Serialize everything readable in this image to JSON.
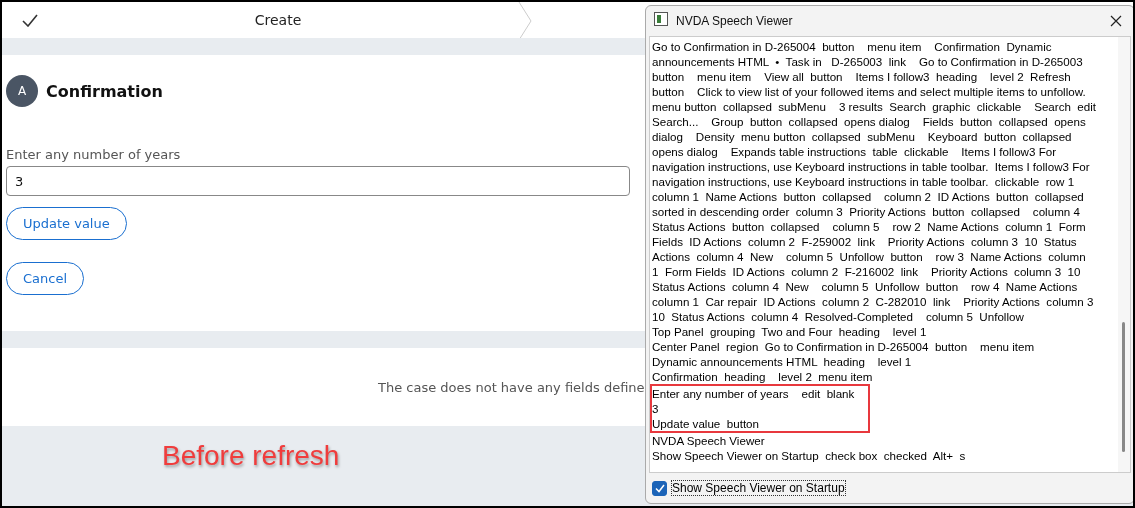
{
  "page": {
    "steps": [
      {
        "label": "Create",
        "completed": true
      }
    ],
    "avatar": "A",
    "heading": "Confirmation",
    "field": {
      "label": "Enter any number of years",
      "value": "3"
    },
    "buttons": [
      "Update value",
      "Cancel"
    ],
    "message": "The case does not have any fields define"
  },
  "annotation": "Before refresh",
  "speech_viewer": {
    "title": "NVDA Speech Viewer",
    "lines": [
      {
        "text": "Go to Confirmation in D-265004  button    menu item    Confirmation  Dynamic",
        "highlighted": false
      },
      {
        "text": "announcements HTML  •  Task in   D-265003  link    Go to Confirmation in D-265003",
        "highlighted": false
      },
      {
        "text": "button    menu item    View all  button    Items I follow3  heading    level 2  Refresh",
        "highlighted": false
      },
      {
        "text": "button    Click to view list of your followed items and select multiple items to unfollow.",
        "highlighted": false
      },
      {
        "text": "menu button  collapsed  subMenu    3 results  Search  graphic  clickable    Search  edit",
        "highlighted": false
      },
      {
        "text": "Search...    Group  button  collapsed  opens dialog    Fields  button  collapsed  opens",
        "highlighted": false
      },
      {
        "text": "dialog    Density  menu button  collapsed  subMenu    Keyboard  button  collapsed",
        "highlighted": false
      },
      {
        "text": "opens dialog    Expands table instructions  table  clickable    Items I follow3 For",
        "highlighted": false
      },
      {
        "text": "navigation instructions, use Keyboard instructions in table toolbar.  Items I follow3 For",
        "highlighted": false
      },
      {
        "text": "navigation instructions, use Keyboard instructions in table toolbar.  clickable  row 1",
        "highlighted": false
      },
      {
        "text": "column 1  Name Actions  button  collapsed    column 2  ID Actions  button  collapsed",
        "highlighted": false
      },
      {
        "text": "sorted in descending order  column 3  Priority Actions  button  collapsed    column 4",
        "highlighted": false
      },
      {
        "text": "Status Actions  button  collapsed    column 5    row 2  Name Actions  column 1  Form",
        "highlighted": false
      },
      {
        "text": "Fields  ID Actions  column 2  F-259002  link    Priority Actions  column 3  10  Status",
        "highlighted": false
      },
      {
        "text": "Actions  column 4  New    column 5  Unfollow  button    row 3  Name Actions  column",
        "highlighted": false
      },
      {
        "text": "1  Form Fields  ID Actions  column 2  F-216002  link    Priority Actions  column 3  10",
        "highlighted": false
      },
      {
        "text": "Status Actions  column 4  New    column 5  Unfollow  button    row 4  Name Actions",
        "highlighted": false
      },
      {
        "text": "column 1  Car repair  ID Actions  column 2  C-282010  link    Priority Actions  column 3",
        "highlighted": false
      },
      {
        "text": "10  Status Actions  column 4  Resolved-Completed    column 5  Unfollow",
        "highlighted": false
      },
      {
        "text": "Top Panel  grouping  Two and Four  heading    level 1",
        "highlighted": false
      },
      {
        "text": "Center Panel  region  Go to Confirmation in D-265004  button    menu item",
        "highlighted": false
      },
      {
        "text": "Dynamic announcements HTML  heading    level 1",
        "highlighted": false
      },
      {
        "text": "Confirmation  heading    level 2  menu item",
        "highlighted": false
      },
      {
        "text": "Enter any number of years    edit  blank",
        "highlighted": true
      },
      {
        "text": "3",
        "highlighted": true
      },
      {
        "text": "Update value  button",
        "highlighted": true
      },
      {
        "text": "NVDA Speech Viewer",
        "highlighted": false
      },
      {
        "text": "Show Speech Viewer on Startup  check box  checked  Alt+  s",
        "highlighted": false
      }
    ],
    "checkbox": {
      "label": "Show Speech Viewer on Startup",
      "checked": true
    }
  }
}
